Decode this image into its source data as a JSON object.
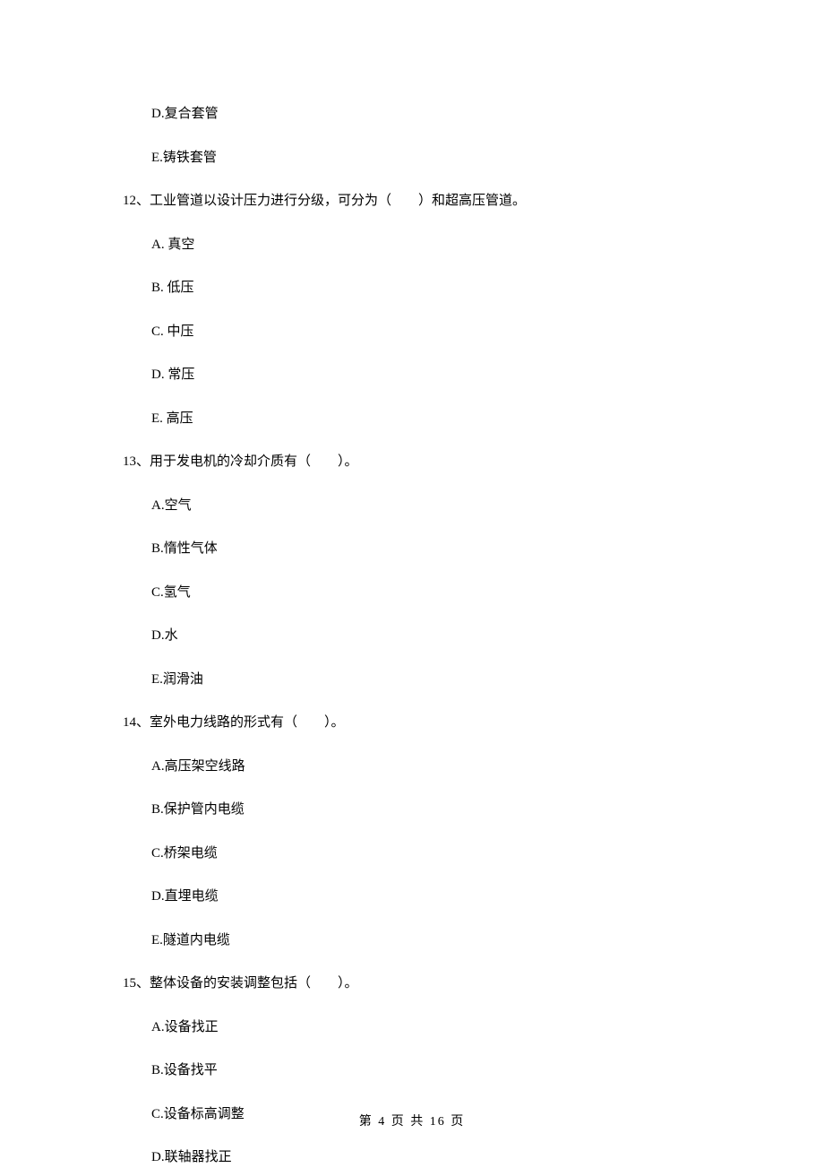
{
  "orphan_options": [
    "D.复合套管",
    "E.铸铁套管"
  ],
  "questions": [
    {
      "number": "12、",
      "text": "工业管道以设计压力进行分级，可分为（　　）和超高压管道。",
      "options": [
        "A.  真空",
        "B.  低压",
        "C.  中压",
        "D.  常压",
        "E.  高压"
      ]
    },
    {
      "number": "13、",
      "text": "用于发电机的冷却介质有（　　）。",
      "options": [
        "A.空气",
        "B.惰性气体",
        "C.氢气",
        "D.水",
        "E.润滑油"
      ]
    },
    {
      "number": "14、",
      "text": "室外电力线路的形式有（　　）。",
      "options": [
        "A.高压架空线路",
        "B.保护管内电缆",
        "C.桥架电缆",
        "D.直埋电缆",
        "E.隧道内电缆"
      ]
    },
    {
      "number": "15、",
      "text": "整体设备的安装调整包括（　　）。",
      "options": [
        "A.设备找正",
        "B.设备找平",
        "C.设备标高调整",
        "D.联轴器找正"
      ]
    }
  ],
  "footer": {
    "page_label": "第 4 页 共 16 页"
  }
}
